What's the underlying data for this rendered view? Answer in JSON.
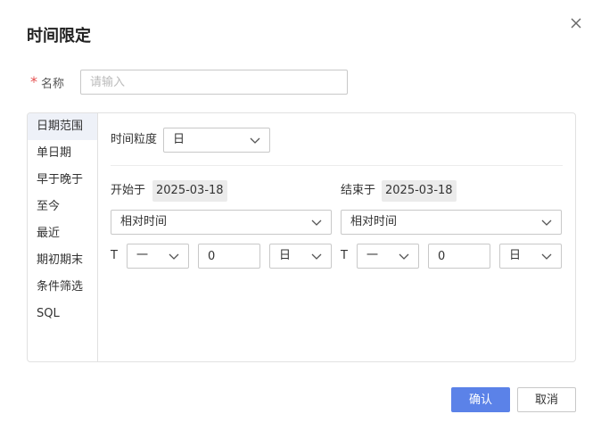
{
  "dialog": {
    "title": "时间限定",
    "required_mark": "*",
    "name_label": "名称",
    "name_placeholder": "请输入",
    "name_value": ""
  },
  "menu": {
    "items": [
      {
        "label": "日期范围",
        "active": true
      },
      {
        "label": "单日期"
      },
      {
        "label": "早于晚于"
      },
      {
        "label": "至今"
      },
      {
        "label": "最近"
      },
      {
        "label": "期初期末"
      },
      {
        "label": "条件筛选"
      },
      {
        "label": "SQL"
      }
    ]
  },
  "granularity": {
    "label": "时间粒度",
    "value": "日"
  },
  "start": {
    "label": "开始于",
    "date": "2025-03-18",
    "mode": "相对时间",
    "t_label": "T",
    "direction": "一",
    "offset": "0",
    "unit": "日"
  },
  "end": {
    "label": "结束于",
    "date": "2025-03-18",
    "mode": "相对时间",
    "t_label": "T",
    "direction": "一",
    "offset": "0",
    "unit": "日"
  },
  "footer": {
    "confirm_label": "确认",
    "cancel_label": "取消"
  },
  "colors": {
    "primary": "#5b82e8",
    "required": "#e55050"
  }
}
